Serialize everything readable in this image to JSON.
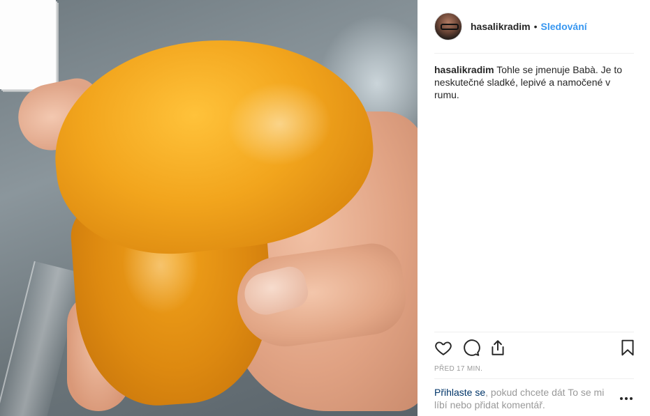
{
  "post": {
    "author": "hasalikradim",
    "separator": "•",
    "follow_label": "Sledování",
    "caption_text": "Tohle se jmenuje Babà. Je to neskutečné sladké, lepivé a namočené v rumu.",
    "timestamp": "PŘED 17 MIN.",
    "login_link": "Přihlaste se",
    "login_rest": ", pokud chcete dát To se mi líbí nebo přidat komentář."
  },
  "icons": {
    "like": "heart-icon",
    "comment": "comment-icon",
    "share": "share-icon",
    "save": "bookmark-icon",
    "more": "more-options-icon"
  },
  "colors": {
    "link_blue": "#3897f0",
    "login_link": "#003569",
    "muted_text": "#999999",
    "text": "#262626"
  }
}
